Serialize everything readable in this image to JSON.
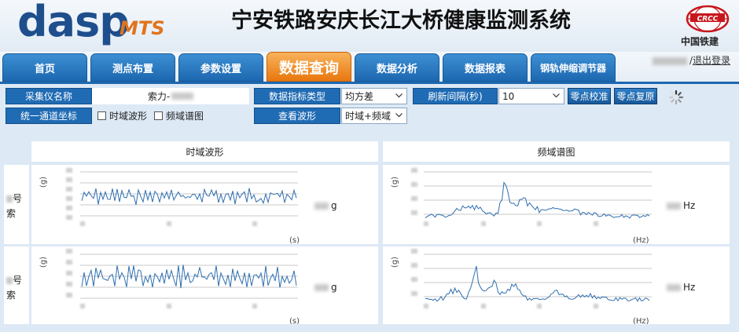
{
  "header": {
    "logo": "dasp",
    "logo_suffix": "MTS",
    "system_title": "宁安铁路安庆长江大桥健康监测系统",
    "company_name": "中国铁建",
    "company_logo_text": "CRCC",
    "user_separator": "/",
    "logout_label": "退出登录"
  },
  "nav": {
    "tabs": [
      {
        "label": "首页"
      },
      {
        "label": "测点布置"
      },
      {
        "label": "参数设置"
      },
      {
        "label": "数据查询",
        "active": true
      },
      {
        "label": "数据分析"
      },
      {
        "label": "数据报表"
      },
      {
        "label": "钢轨伸缩调节器"
      }
    ]
  },
  "controls": {
    "instrument_label": "采集仪名称",
    "instrument_value_prefix": "索力-",
    "indicator_type_label": "数据指标类型",
    "indicator_type_value": "均方差",
    "refresh_label": "刷新间隔(秒)",
    "refresh_value": "10",
    "zero_calibrate_label": "零点校准",
    "zero_restore_label": "零点复原",
    "unify_axis_label": "统一通道坐标",
    "time_waveform_check": "时域波形",
    "freq_spectrum_check": "频域谱图",
    "view_waveform_label": "查看波形",
    "view_waveform_value": "时域+频域"
  },
  "charts": {
    "time_header": "时域波形",
    "freq_header": "频域谱图",
    "time_y_unit": "(g)",
    "time_x_unit": "(s)",
    "freq_y_unit": "(g)",
    "freq_x_unit": "(Hz)",
    "rows": [
      {
        "label_top": "号",
        "label_bottom": "索",
        "value_unit": "g",
        "freq_unit": "Hz"
      },
      {
        "label_top": "号",
        "label_bottom": "索",
        "value_unit": "g",
        "freq_unit": "Hz"
      }
    ]
  },
  "colors": {
    "nav_tab": "#1d68b0",
    "nav_tab_active": "#e8770e",
    "label_bg": "#1f6bb4",
    "panel_bg": "#dde9f5",
    "waveform_line": "#2f6fb0",
    "logo_blue": "#1e4f8c",
    "logo_orange": "#e0741b"
  }
}
